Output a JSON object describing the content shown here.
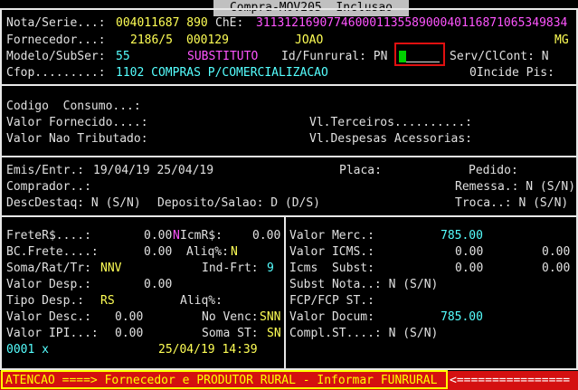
{
  "window_title": "Compra-MOV205  Inclusao",
  "header": {
    "nota_label": "Nota/Serie...:",
    "nota_value": "004011687 890",
    "chave_label": "ChE:",
    "chave_value": "31131216907746000113558900040116871065349834",
    "fornecedor_label": "Fornecedor...:",
    "fornecedor_code": "2186/5",
    "fornecedor_code2": "000129",
    "fornecedor_name": "JOAO",
    "fornecedor_uf": "MG",
    "modelo_label": "Modelo/SubSer:",
    "modelo_value": "55",
    "substituto": "SUBSTITUTO",
    "funrural_label": "Id/Funrural: PN",
    "servcl_label": "Serv/ClCont: N",
    "cfop_label": "Cfop.........:",
    "cfop_value": "1102 COMPRAS P/COMERCIALIZACAO",
    "incide_label": "0Incide Pis:"
  },
  "section2": {
    "codigo": "Codigo  Consumo...:",
    "valor_fornecido": "Valor Fornecido....:",
    "valor_nao_trib": "Valor Nao Tributado:",
    "vl_terceiros": "Vl.Terceiros..........:",
    "vl_despesas": "Vl.Despesas Acessorias:"
  },
  "section3": {
    "emis_label": "Emis/Entr.:",
    "emis_value": "19/04/19 25/04/19",
    "placa": "Placa:",
    "pedido": "Pedido:",
    "comprador": "Comprador..:",
    "remessa": "Remessa.: N (S/N)",
    "descdestaq": "DescDestaq: N (S/N)",
    "deposito": "Deposito/Salao: D (D/S)",
    "troca": "Troca..: N (S/N)"
  },
  "left_panel": {
    "frete_label": "FreteR$....:",
    "frete_value": "0.00",
    "icmr_n": "N",
    "icmr_label": "IcmR$:",
    "icmr_value": "0.00",
    "bcfrete_label": "BC.Frete....:",
    "bcfrete_value": "0.00",
    "aliq_label": "Aliq%:",
    "aliq_value": "N",
    "soma_label": "Soma/Rat/Tr:",
    "soma_value": "NNV",
    "indfrt_label": "Ind-Frt:",
    "indfrt_value": "9",
    "valor_desp_label": "Valor Desp.:",
    "valor_desp_value": "0.00",
    "tipo_desp_label": "Tipo Desp.:",
    "tipo_desp_value": "RS",
    "aliq2_label": "Aliq%:",
    "valor_desc_label": "Valor Desc.:",
    "valor_desc_value": "0.00",
    "novenc_label": "No Venc:",
    "novenc_value": "SNN",
    "valor_ipi_label": "Valor IPI...:",
    "valor_ipi_value": "0.00",
    "somast_label": "Soma ST:",
    "somast_value": "SN",
    "footer_id": "0001 x",
    "footer_datetime": "25/04/19 14:39"
  },
  "right_panel": {
    "valor_merc_label": "Valor Merc.:",
    "valor_merc_value": "785.00",
    "valor_icms_label": "Valor ICMS.:",
    "valor_icms_value": "0.00",
    "valor_icms_value2": "0.00",
    "icms_subst_label": "Icms  Subst:",
    "icms_subst_value": "0.00",
    "icms_subst_value2": "0.00",
    "subst_nota": "Subst Nota..: N (S/N)",
    "fcp_st": "FCP/FCP ST.:",
    "valor_docum_label": "Valor Docum:",
    "valor_docum_value": "785.00",
    "compl_st": "Compl.ST....: N (S/N)"
  },
  "alert": {
    "message": "ATENCAO ====> Fornecedor e PRODUTOR RURAL - Informar FUNRURAL",
    "tail": "<================"
  }
}
